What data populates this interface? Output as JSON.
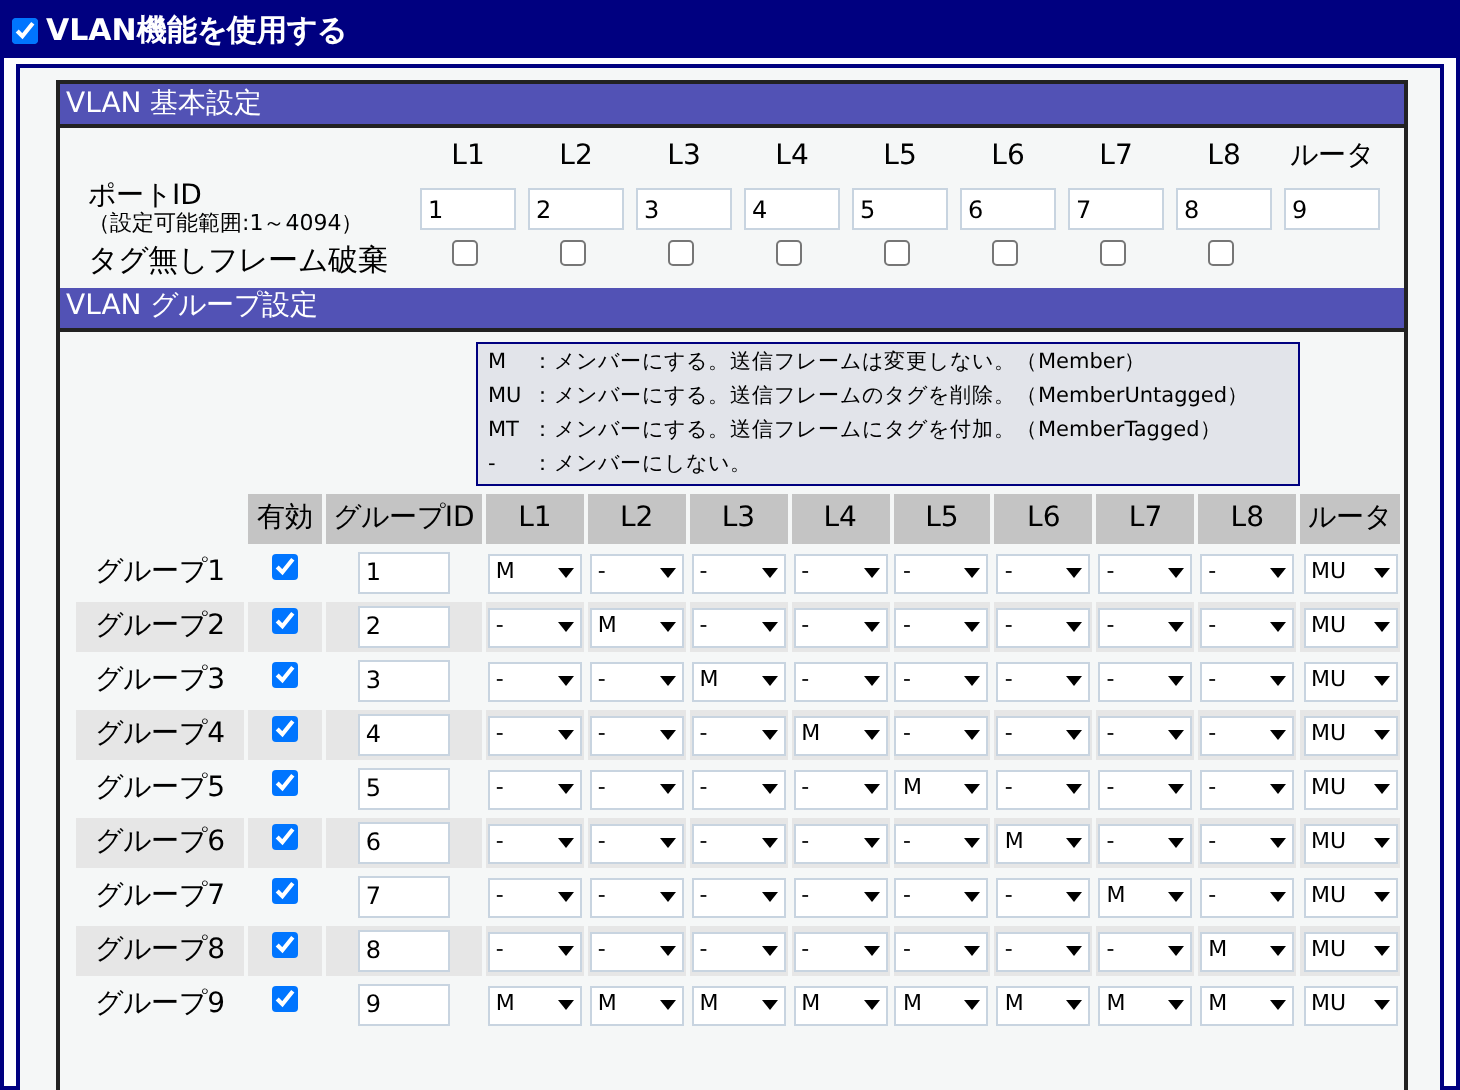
{
  "title": {
    "label": "VLAN機能を使用する",
    "checked": true
  },
  "basic": {
    "heading": "VLAN 基本設定",
    "port_id_label": "ポートID",
    "range_note": "（設定可能範囲:1～4094）",
    "discard_label": "タグ無しフレーム破棄",
    "ports": [
      {
        "label": "L1",
        "port_id": "1",
        "discard_untagged": false
      },
      {
        "label": "L2",
        "port_id": "2",
        "discard_untagged": false
      },
      {
        "label": "L3",
        "port_id": "3",
        "discard_untagged": false
      },
      {
        "label": "L4",
        "port_id": "4",
        "discard_untagged": false
      },
      {
        "label": "L5",
        "port_id": "5",
        "discard_untagged": false
      },
      {
        "label": "L6",
        "port_id": "6",
        "discard_untagged": false
      },
      {
        "label": "L7",
        "port_id": "7",
        "discard_untagged": false
      },
      {
        "label": "L8",
        "port_id": "8",
        "discard_untagged": false
      },
      {
        "label": "ルータ",
        "port_id": "9"
      }
    ]
  },
  "group": {
    "heading": "VLAN グループ設定",
    "legend": [
      {
        "code": "M",
        "text": "：メンバーにする。送信フレームは変更しない。（Member）"
      },
      {
        "code": "MU",
        "text": "：メンバーにする。送信フレームのタグを削除。（MemberUntagged）"
      },
      {
        "code": "MT",
        "text": "：メンバーにする。送信フレームにタグを付加。（MemberTagged）"
      },
      {
        "code": "-",
        "text": "：メンバーにしない。"
      }
    ],
    "columns": [
      "有効",
      "グループID",
      "L1",
      "L2",
      "L3",
      "L4",
      "L5",
      "L6",
      "L7",
      "L8",
      "ルータ"
    ],
    "rows": [
      {
        "name": "グループ1",
        "enabled": true,
        "group_id": "1",
        "members": [
          "M",
          "-",
          "-",
          "-",
          "-",
          "-",
          "-",
          "-",
          "MU"
        ]
      },
      {
        "name": "グループ2",
        "enabled": true,
        "group_id": "2",
        "members": [
          "-",
          "M",
          "-",
          "-",
          "-",
          "-",
          "-",
          "-",
          "MU"
        ]
      },
      {
        "name": "グループ3",
        "enabled": true,
        "group_id": "3",
        "members": [
          "-",
          "-",
          "M",
          "-",
          "-",
          "-",
          "-",
          "-",
          "MU"
        ]
      },
      {
        "name": "グループ4",
        "enabled": true,
        "group_id": "4",
        "members": [
          "-",
          "-",
          "-",
          "M",
          "-",
          "-",
          "-",
          "-",
          "MU"
        ]
      },
      {
        "name": "グループ5",
        "enabled": true,
        "group_id": "5",
        "members": [
          "-",
          "-",
          "-",
          "-",
          "M",
          "-",
          "-",
          "-",
          "MU"
        ]
      },
      {
        "name": "グループ6",
        "enabled": true,
        "group_id": "6",
        "members": [
          "-",
          "-",
          "-",
          "-",
          "-",
          "M",
          "-",
          "-",
          "MU"
        ]
      },
      {
        "name": "グループ7",
        "enabled": true,
        "group_id": "7",
        "members": [
          "-",
          "-",
          "-",
          "-",
          "-",
          "-",
          "M",
          "-",
          "MU"
        ]
      },
      {
        "name": "グループ8",
        "enabled": true,
        "group_id": "8",
        "members": [
          "-",
          "-",
          "-",
          "-",
          "-",
          "-",
          "-",
          "M",
          "MU"
        ]
      },
      {
        "name": "グループ9",
        "enabled": true,
        "group_id": "9",
        "members": [
          "M",
          "M",
          "M",
          "M",
          "M",
          "M",
          "M",
          "M",
          "MU"
        ]
      }
    ]
  }
}
